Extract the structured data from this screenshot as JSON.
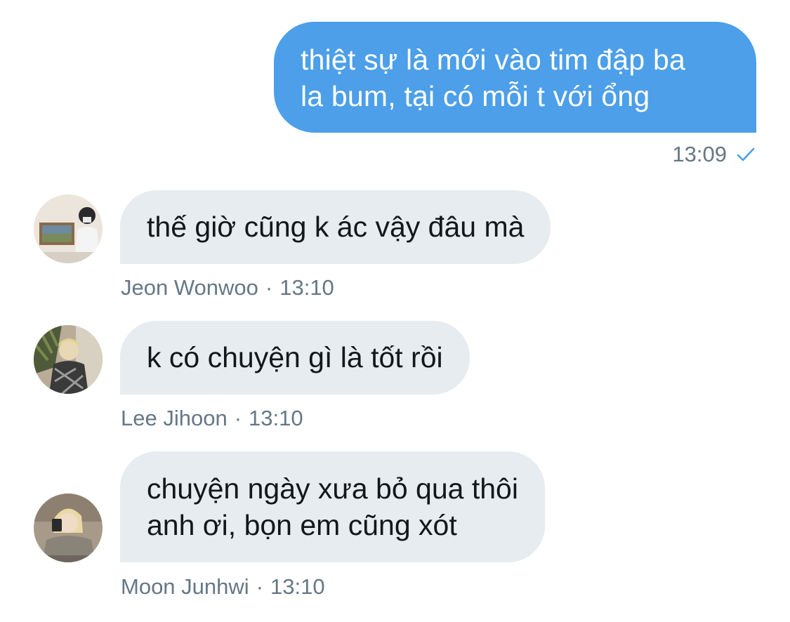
{
  "outgoing": {
    "lines": [
      "thiệt sự là mới vào tim đập ba",
      "la bum, tại có mỗi t với ổng"
    ],
    "time": "13:09",
    "status_icon": "check-icon",
    "bubble_color": "#4c9fe8"
  },
  "incoming": [
    {
      "lines": [
        "thế giờ cũng k ác vậy đâu mà"
      ],
      "sender": "Jeon Wonwoo",
      "separator": "·",
      "time": "13:10",
      "avatar_icon": "avatar-photo"
    },
    {
      "lines": [
        "k có chuyện gì là tốt rồi"
      ],
      "sender": "Lee Jihoon",
      "separator": "·",
      "time": "13:10",
      "avatar_icon": "avatar-photo"
    },
    {
      "lines": [
        "chuyện ngày xưa bỏ qua thôi",
        "anh ơi, bọn em cũng xót"
      ],
      "sender": "Moon Junhwi",
      "separator": "·",
      "time": "13:10",
      "avatar_icon": "avatar-photo"
    }
  ],
  "colors": {
    "incoming_bubble": "#e6ecf0",
    "meta_text": "#657786",
    "check": "#4c9fe8"
  }
}
